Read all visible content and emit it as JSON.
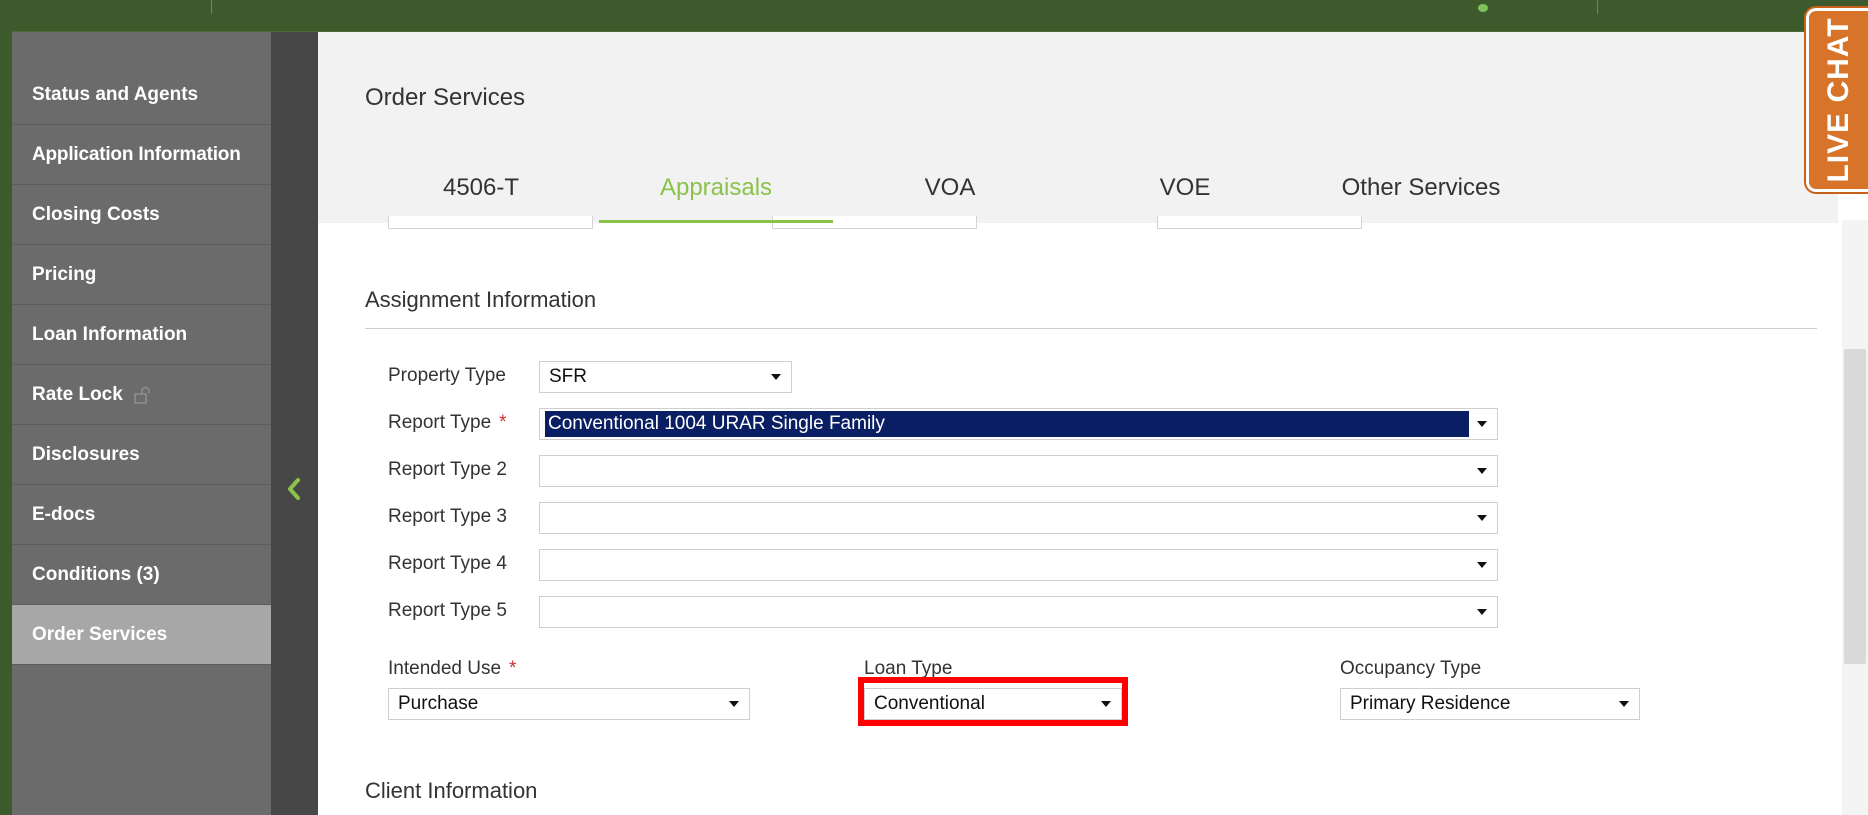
{
  "sidebar": {
    "items": [
      {
        "label": "Status and Agents"
      },
      {
        "label": "Application Information"
      },
      {
        "label": "Closing Costs"
      },
      {
        "label": "Pricing"
      },
      {
        "label": "Loan Information"
      },
      {
        "label": "Rate Lock"
      },
      {
        "label": "Disclosures"
      },
      {
        "label": "E-docs"
      },
      {
        "label": "Conditions (3)"
      },
      {
        "label": "Order Services"
      }
    ],
    "active_item": "Order Services"
  },
  "page": {
    "title": "Order Services"
  },
  "tabs": [
    {
      "label": "4506-T"
    },
    {
      "label": "Appraisals"
    },
    {
      "label": "VOA"
    },
    {
      "label": "VOE"
    },
    {
      "label": "Other Services"
    }
  ],
  "active_tab": "Appraisals",
  "assignment": {
    "title": "Assignment Information",
    "property_type": {
      "label": "Property Type",
      "value": "SFR"
    },
    "report_type": {
      "label": "Report Type",
      "required_mark": "*",
      "value": "Conventional 1004 URAR Single Family"
    },
    "report_type_2": {
      "label": "Report Type 2",
      "value": ""
    },
    "report_type_3": {
      "label": "Report Type 3",
      "value": ""
    },
    "report_type_4": {
      "label": "Report Type 4",
      "value": ""
    },
    "report_type_5": {
      "label": "Report Type 5",
      "value": ""
    },
    "intended_use": {
      "label": "Intended Use",
      "required_mark": "*",
      "value": "Purchase"
    },
    "loan_type": {
      "label": "Loan Type",
      "value": "Conventional"
    },
    "occupancy_type": {
      "label": "Occupancy Type",
      "value": "Primary Residence"
    }
  },
  "client": {
    "title": "Client Information"
  },
  "live_chat": {
    "label": "LIVE CHAT"
  },
  "colors": {
    "accent_green": "#8bc34a",
    "top_bar": "#3c5a2c",
    "sidebar_bg": "#6b6b6b",
    "sidebar_active": "#a7a7a7",
    "live_chat": "#d8742a",
    "highlight_box": "#ff0000",
    "selection_bg": "#0a1f63"
  }
}
